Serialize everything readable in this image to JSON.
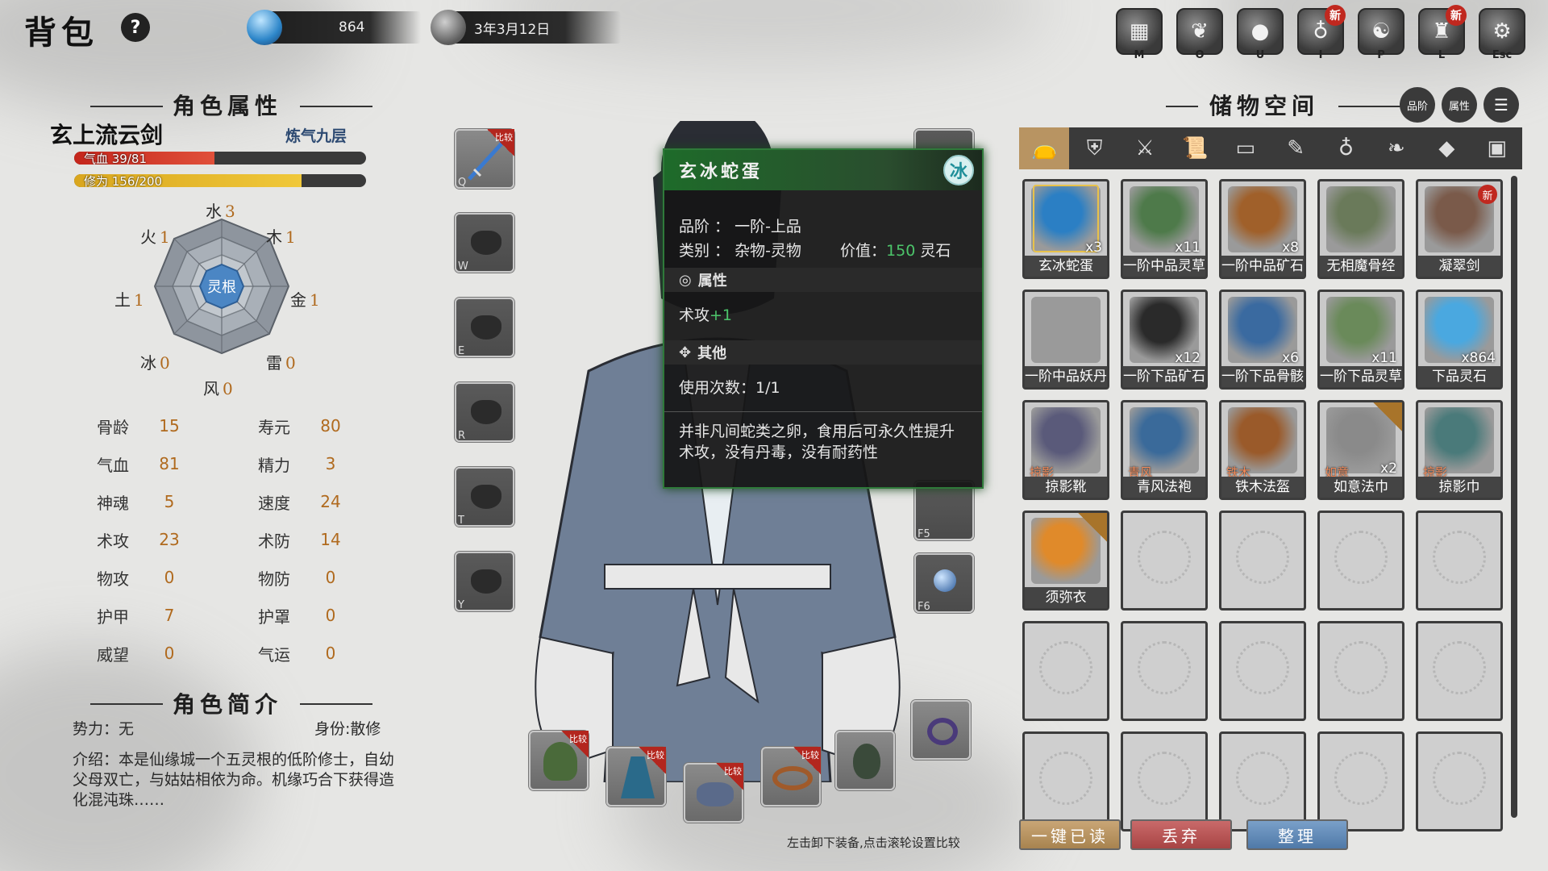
{
  "header": {
    "title": "背包",
    "help": "?",
    "spirit_stones": "864",
    "date": "3年3月12日"
  },
  "top_menu": [
    {
      "key": "M",
      "icon": "map-icon",
      "new": false
    },
    {
      "key": "O",
      "icon": "scroll-icon",
      "new": false
    },
    {
      "key": "U",
      "icon": "orb-icon",
      "new": false
    },
    {
      "key": "I",
      "icon": "gourd-icon",
      "new": true
    },
    {
      "key": "P",
      "icon": "yinyang-icon",
      "new": false
    },
    {
      "key": "L",
      "icon": "figure-icon",
      "new": true
    },
    {
      "key": "Esc",
      "icon": "gear-icon",
      "new": false
    }
  ],
  "new_badge": "新",
  "character": {
    "section_title": "角色属性",
    "name": "玄上流云剑",
    "realm": "炼气九层",
    "hp_label": "气血 39/81",
    "hp_fraction": 0.48,
    "xp_label": "修为 156/200",
    "xp_fraction": 0.78,
    "root_label": "灵根",
    "elements": [
      {
        "name": "水",
        "value": "3"
      },
      {
        "name": "木",
        "value": "1"
      },
      {
        "name": "金",
        "value": "1"
      },
      {
        "name": "雷",
        "value": "0"
      },
      {
        "name": "风",
        "value": "0"
      },
      {
        "name": "冰",
        "value": "0"
      },
      {
        "name": "土",
        "value": "1"
      },
      {
        "name": "火",
        "value": "1"
      }
    ],
    "stats": [
      {
        "l1": "骨龄",
        "v1": "15",
        "l2": "寿元",
        "v2": "80"
      },
      {
        "l1": "气血",
        "v1": "81",
        "l2": "精力",
        "v2": "3"
      },
      {
        "l1": "神魂",
        "v1": "5",
        "l2": "速度",
        "v2": "24"
      },
      {
        "l1": "术攻",
        "v1": "23",
        "l2": "术防",
        "v2": "14"
      },
      {
        "l1": "物攻",
        "v1": "0",
        "l2": "物防",
        "v2": "0"
      },
      {
        "l1": "护甲",
        "v1": "7",
        "l2": "护罩",
        "v2": "0"
      },
      {
        "l1": "威望",
        "v1": "0",
        "l2": "气运",
        "v2": "0"
      }
    ],
    "bio_title": "角色简介",
    "faction": "势力：无",
    "identity": "身份:散修",
    "intro": "介绍：本是仙缘城一个五灵根的低阶修士，自幼父母双亡，与姑姑相依为命。机缘巧合下获得造化混沌珠……"
  },
  "skill_slots": [
    "Q",
    "W",
    "E",
    "R",
    "T",
    "Y"
  ],
  "side_slots": [
    "F5",
    "F6"
  ],
  "compare_tag": "比较",
  "tooltip": {
    "name": "玄冰蛇蛋",
    "badge": "冰",
    "grade": "品阶 ： 一阶-上品",
    "category": "类别 ： 杂物-灵物",
    "value_label": "价值：",
    "value": "150",
    "value_unit": "灵石",
    "attr_title": "属性",
    "attr_name": "术攻",
    "attr_value": "+1",
    "other_title": "其他",
    "uses": "使用次数：1/1",
    "desc": "并非凡间蛇类之卵，食用后可永久性提升术攻，没有丹毒，没有耐药性"
  },
  "storage": {
    "title": "储物空间",
    "sort_grade": "品阶",
    "sort_attr": "属性",
    "tabs": [
      "bag-icon",
      "robe-icon",
      "sword-icon",
      "scroll-icon",
      "book-icon",
      "talisman-icon",
      "gourd-icon",
      "leaf-icon",
      "ore-icon",
      "chest-icon"
    ],
    "items": [
      {
        "name": "玄冰蛇蛋",
        "count": "x3",
        "color": "#2b7fc4",
        "selected": true
      },
      {
        "name": "一阶中品灵草",
        "count": "x11",
        "color": "#4e7a4a"
      },
      {
        "name": "一阶中品矿石",
        "count": "x8",
        "color": "#a0602a"
      },
      {
        "name": "无相魔骨经",
        "count": "",
        "color": "#6a7a5a"
      },
      {
        "name": "凝翠剑",
        "count": "",
        "color": "#7a5a4a",
        "new": true
      },
      {
        "name": "一阶中品妖丹",
        "count": "",
        "color": "#9a9a9a"
      },
      {
        "name": "一阶下品矿石",
        "count": "x12",
        "color": "#2a2a2a"
      },
      {
        "name": "一阶下品骨骸",
        "count": "x6",
        "color": "#3a6aa0"
      },
      {
        "name": "一阶下品灵草",
        "count": "x11",
        "color": "#6a8a5a"
      },
      {
        "name": "下品灵石",
        "count": "x864",
        "color": "#4aa8e0"
      },
      {
        "name": "掠影靴",
        "count": "",
        "prefix": "掠影",
        "color": "#5a5a7a"
      },
      {
        "name": "青风法袍",
        "count": "",
        "prefix": "青风",
        "color": "#3a6a9a"
      },
      {
        "name": "铁木法盔",
        "count": "",
        "prefix": "铁木",
        "color": "#9a5a2a"
      },
      {
        "name": "如意法巾",
        "count": "x2",
        "prefix": "如意",
        "color": "#8a8a8a",
        "compare": true
      },
      {
        "name": "掠影巾",
        "count": "",
        "prefix": "掠影",
        "color": "#4a7a7a"
      },
      {
        "name": "须弥衣",
        "count": "",
        "color": "#e08a2a",
        "compare": true
      }
    ]
  },
  "buttons": {
    "read_all": "一键已读",
    "discard": "丢弃",
    "sort": "整理"
  },
  "hint": "左击卸下装备,点击滚轮设置比较"
}
